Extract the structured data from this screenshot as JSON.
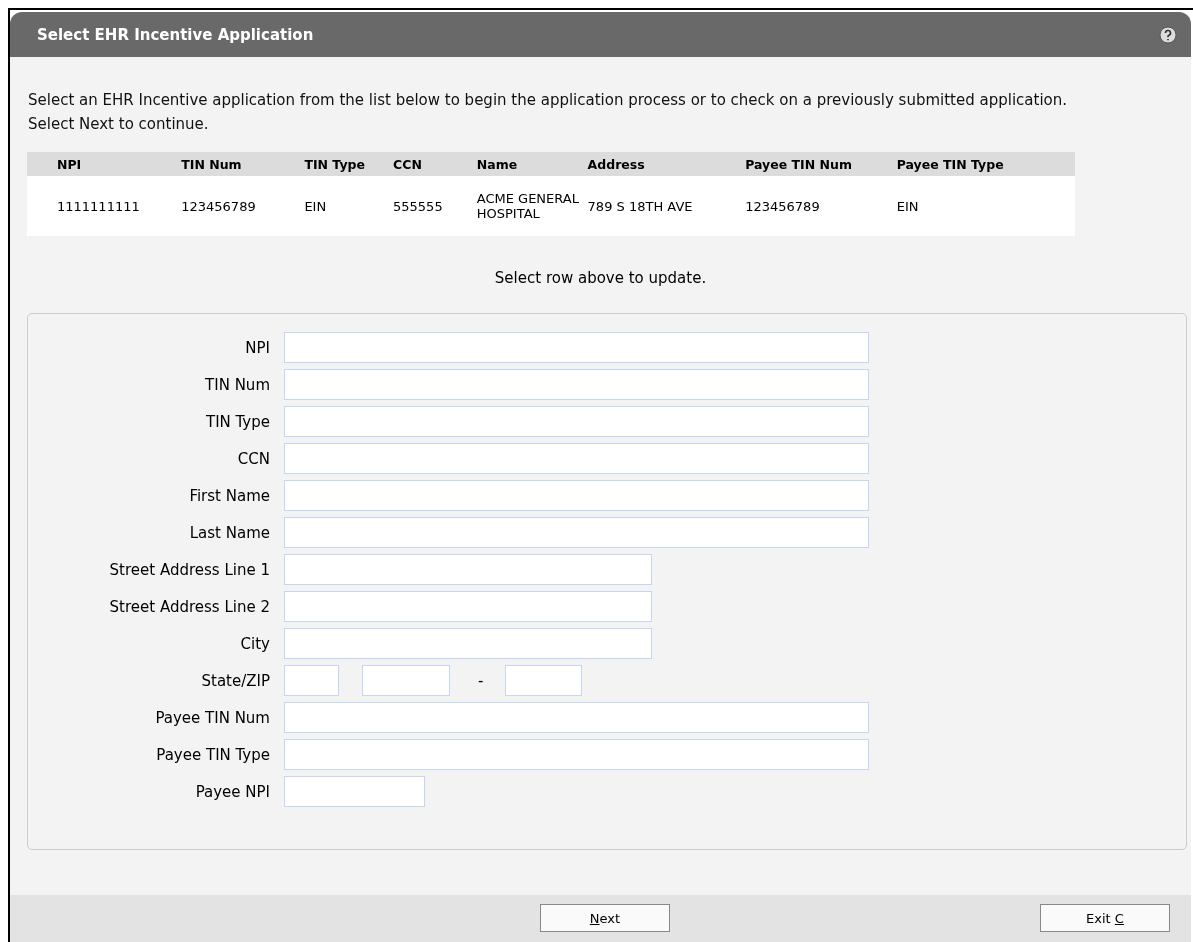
{
  "window": {
    "title": "Select EHR Incentive Application"
  },
  "intro": "Select an EHR Incentive application from the list below to begin the application process or to check on a previously submitted application. Select Next to continue.",
  "table": {
    "columns": [
      "NPI",
      "TIN Num",
      "TIN Type",
      "CCN",
      "Name",
      "Address",
      "Payee TIN Num",
      "Payee TIN Type"
    ],
    "rows": [
      [
        "1111111111",
        "123456789",
        "EIN",
        "555555",
        "ACME GENERAL HOSPITAL",
        "789 S 18TH AVE",
        "123456789",
        "EIN"
      ]
    ]
  },
  "hint": "Select row above to update.",
  "form": {
    "fields": [
      {
        "label": "NPI",
        "kind": "wide"
      },
      {
        "label": "TIN Num",
        "kind": "wide"
      },
      {
        "label": "TIN Type",
        "kind": "wide"
      },
      {
        "label": "CCN",
        "kind": "wide"
      },
      {
        "label": "First Name",
        "kind": "wide"
      },
      {
        "label": "Last Name",
        "kind": "wide"
      },
      {
        "label": "Street Address Line 1",
        "kind": "medium"
      },
      {
        "label": "Street Address Line 2",
        "kind": "medium"
      },
      {
        "label": "City",
        "kind": "medium"
      },
      {
        "label": "State/ZIP",
        "kind": "state_zip",
        "separator": "-"
      },
      {
        "label": "Payee TIN Num",
        "kind": "wide"
      },
      {
        "label": "Payee TIN Type",
        "kind": "wide"
      },
      {
        "label": "Payee NPI",
        "kind": "short"
      }
    ]
  },
  "buttons": [
    {
      "access_key": "N",
      "label_after": "ext"
    },
    {
      "label_before": "Exit ",
      "access_key": "C"
    }
  ]
}
